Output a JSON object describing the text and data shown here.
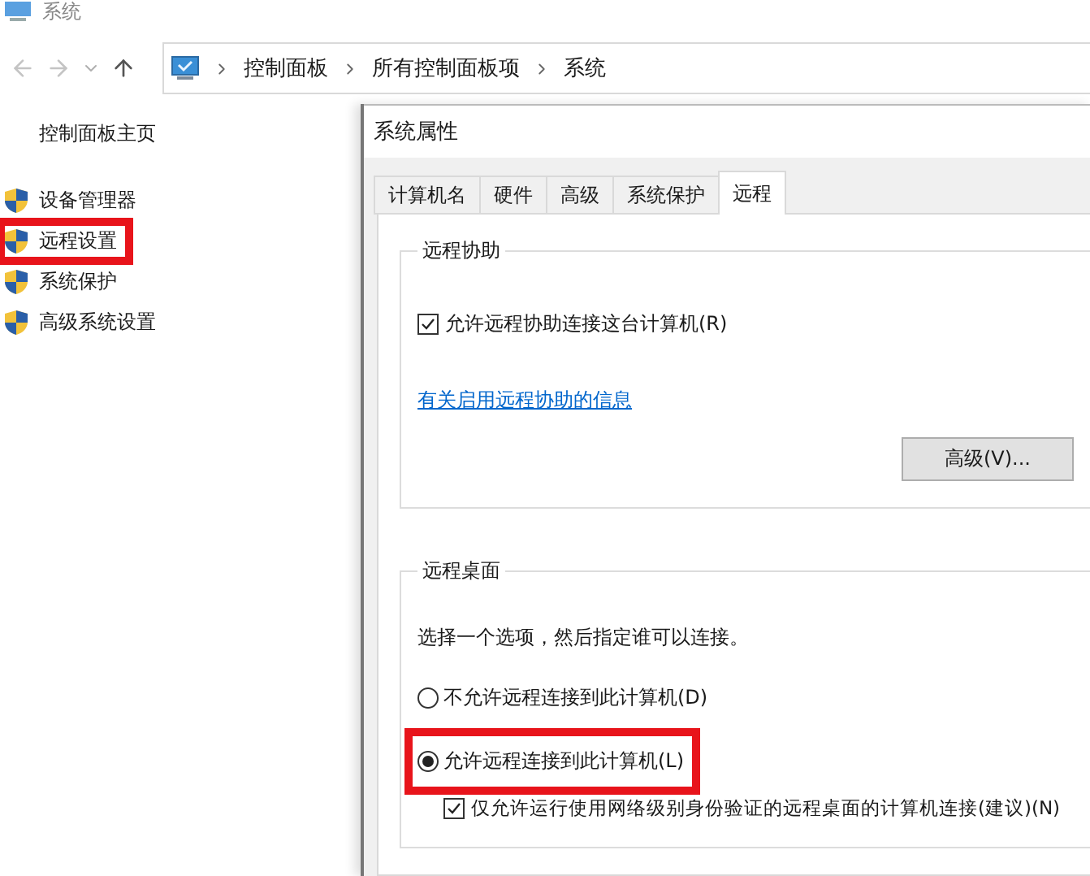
{
  "window": {
    "title": "系统"
  },
  "address_bar": {
    "path": [
      "控制面板",
      "所有控制面板项",
      "系统"
    ]
  },
  "sidebar": {
    "home_link": "控制面板主页",
    "items": [
      {
        "label": "设备管理器",
        "highlighted": false
      },
      {
        "label": "远程设置",
        "highlighted": true
      },
      {
        "label": "系统保护",
        "highlighted": false
      },
      {
        "label": "高级系统设置",
        "highlighted": false
      }
    ]
  },
  "dialog": {
    "title": "系统属性",
    "tabs": [
      {
        "label": "计算机名",
        "selected": false
      },
      {
        "label": "硬件",
        "selected": false
      },
      {
        "label": "高级",
        "selected": false
      },
      {
        "label": "系统保护",
        "selected": false
      },
      {
        "label": "远程",
        "selected": true
      }
    ],
    "remote_assistance": {
      "title": "远程协助",
      "checkbox": {
        "label": "允许远程协助连接这台计算机(R)",
        "checked": true
      },
      "link": "有关启用远程协助的信息",
      "button": "高级(V)..."
    },
    "remote_desktop": {
      "title": "远程桌面",
      "instruction": "选择一个选项，然后指定谁可以连接。",
      "options": [
        {
          "label": "不允许远程连接到此计算机(D)",
          "selected": false,
          "highlighted": false
        },
        {
          "label": "允许远程连接到此计算机(L)",
          "selected": true,
          "highlighted": true
        }
      ],
      "nla_checkbox": {
        "label": "仅允许运行使用网络级别身份验证的远程桌面的计算机连接(建议)(N)",
        "checked": true
      }
    }
  }
}
